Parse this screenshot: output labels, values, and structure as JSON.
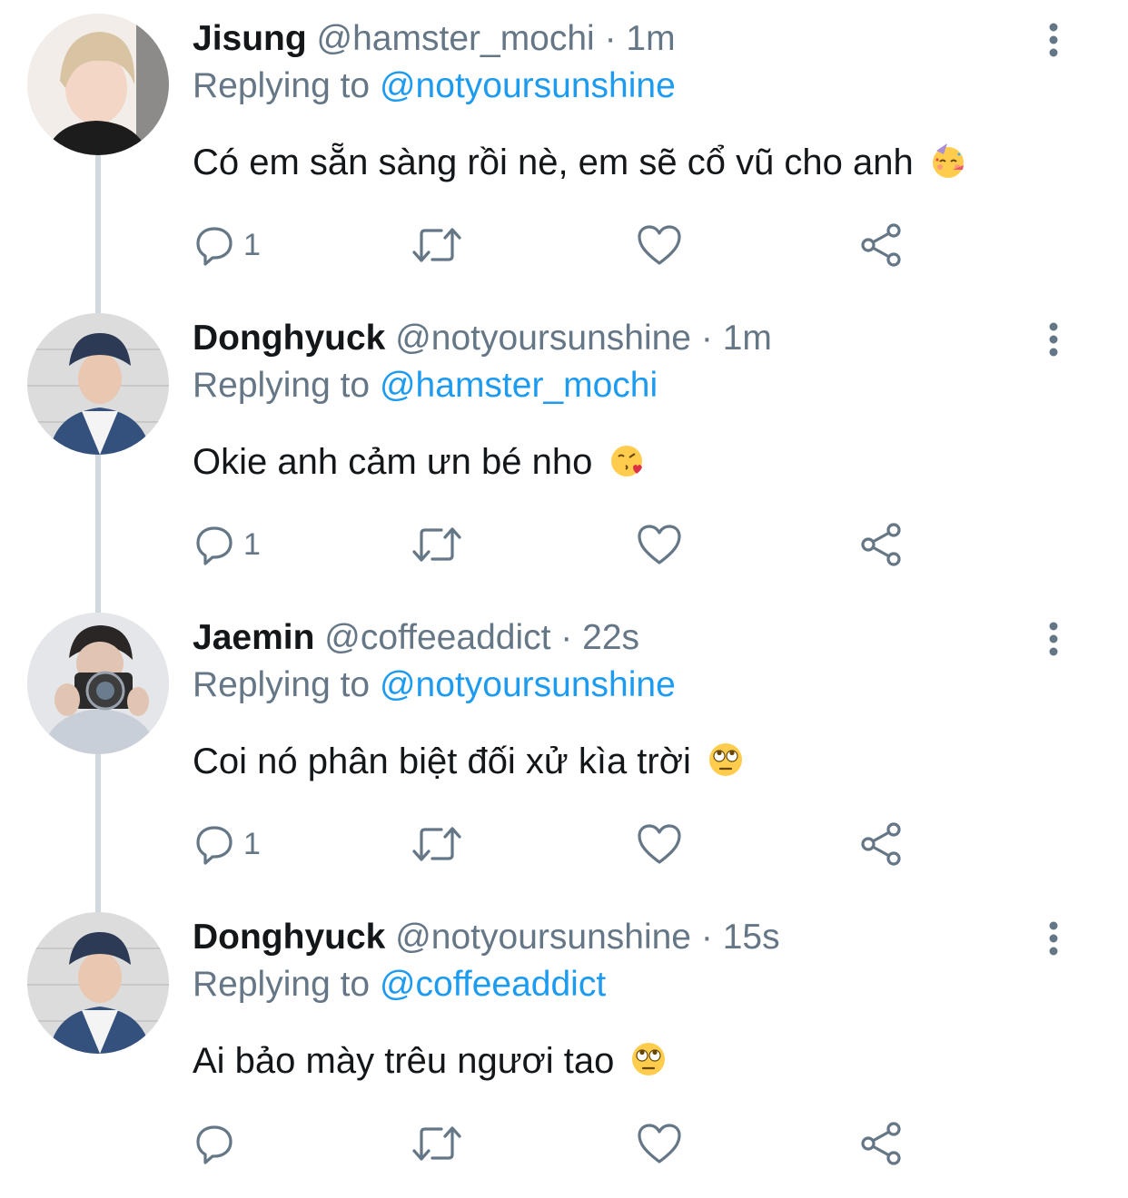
{
  "tweets": [
    {
      "name": "Jisung",
      "handle": "@hamster_mochi",
      "separator": "·",
      "time": "1m",
      "replying_label": "Replying to",
      "replying_to": "@notyoursunshine",
      "text": "Có em sẵn sàng rồi nè, em sẽ cổ vũ cho anh",
      "emoji": "partying-face-emoji",
      "reply_count": "1",
      "avatar_colors": {
        "bg": "#f2ede8",
        "hair": "#d8c3a3",
        "skin": "#f3d6c6",
        "shirt": "#1c1c1c"
      }
    },
    {
      "name": "Donghyuck",
      "handle": "@notyoursunshine",
      "separator": "·",
      "time": "1m",
      "replying_label": "Replying to",
      "replying_to": "@hamster_mochi",
      "text": "Okie anh cảm ưn bé nho",
      "emoji": "face-blowing-kiss-emoji",
      "reply_count": "1",
      "avatar_colors": {
        "bg": "#dcdcdc",
        "hair": "#2d3a55",
        "skin": "#e9c7b0",
        "shirt": "#34507d"
      }
    },
    {
      "name": "Jaemin",
      "handle": "@coffeeaddict",
      "separator": "·",
      "time": "22s",
      "replying_label": "Replying to",
      "replying_to": "@notyoursunshine",
      "text": "Coi nó phân biệt đối xử kìa trời",
      "emoji": "face-with-rolling-eyes-emoji",
      "reply_count": "1",
      "avatar_colors": {
        "bg": "#e4e6e9",
        "hair": "#2a2626",
        "skin": "#e2c4b2",
        "shirt": "#c9cfd8"
      }
    },
    {
      "name": "Donghyuck",
      "handle": "@notyoursunshine",
      "separator": "·",
      "time": "15s",
      "replying_label": "Replying to",
      "replying_to": "@coffeeaddict",
      "text": "Ai bảo mày trêu ngươi tao",
      "emoji": "face-with-rolling-eyes-emoji",
      "reply_count": "",
      "avatar_colors": {
        "bg": "#dcdcdc",
        "hair": "#2d3a55",
        "skin": "#e9c7b0",
        "shirt": "#34507d"
      }
    }
  ],
  "icons": {
    "reply": "reply-bubble-icon",
    "retweet": "retweet-icon",
    "like": "heart-icon",
    "share": "share-icon",
    "more": "more-vertical-icon"
  },
  "colors": {
    "text": "#14171a",
    "secondary": "#657786",
    "mention": "#1d9bf0",
    "thread_line": "#cfd9de"
  }
}
